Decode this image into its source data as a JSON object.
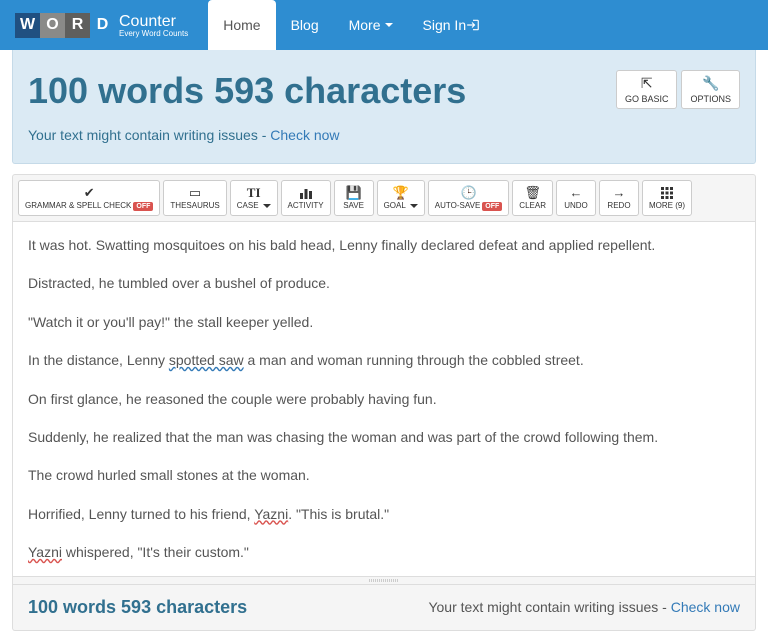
{
  "logo": {
    "letters": [
      "W",
      "O",
      "R",
      "D"
    ],
    "colors": [
      "#205081",
      "#8a8a88",
      "#5f5f5d",
      "#2e8dd1"
    ],
    "title": "Counter",
    "subtitle": "Every Word Counts"
  },
  "nav": {
    "home": "Home",
    "blog": "Blog",
    "more": "More",
    "signin": "Sign In "
  },
  "header": {
    "title": "100 words 593 characters",
    "goBasic": "GO BASIC",
    "options": "OPTIONS",
    "issuesPrefix": "Your text might contain writing issues - ",
    "checkNow": "Check now"
  },
  "toolbar": {
    "grammar": "GRAMMAR & SPELL CHECK",
    "off": "OFF",
    "thesaurus": "THESAURUS",
    "case": "CASE",
    "activity": "ACTIVITY",
    "save": "SAVE",
    "goal": "GOAL",
    "autosave": "AUTO-SAVE",
    "clear": "CLEAR",
    "undo": "UNDO",
    "redo": "REDO",
    "more": "MORE (9)"
  },
  "text": {
    "p1": "It was hot. Swatting mosquitoes on his bald head, Lenny finally declared defeat and applied repellent.",
    "p2": "Distracted, he tumbled over a bushel of produce.",
    "p3": "\"Watch it or you'll pay!\" the stall keeper yelled.",
    "p4a": "In the distance, Lenny ",
    "p4b": "spotted saw",
    "p4c": " a man and woman running through the cobbled street.",
    "p5": "On first glance, he reasoned the couple were probably having fun.",
    "p6": "Suddenly, he realized that the man was chasing the woman and was part of the crowd following them.",
    "p7": "The crowd hurled small stones at the woman.",
    "p8a": "Horrified, Lenny turned to his friend, ",
    "p8b": "Yazni",
    "p8c": ". \"This is brutal.\"",
    "p9a": "Yazni",
    "p9b": " whispered, \"It's their custom.\""
  },
  "footer": {
    "count": "100 words 593 characters",
    "issuesPrefix": "Your text might contain writing issues - ",
    "checkNow": "Check now"
  }
}
